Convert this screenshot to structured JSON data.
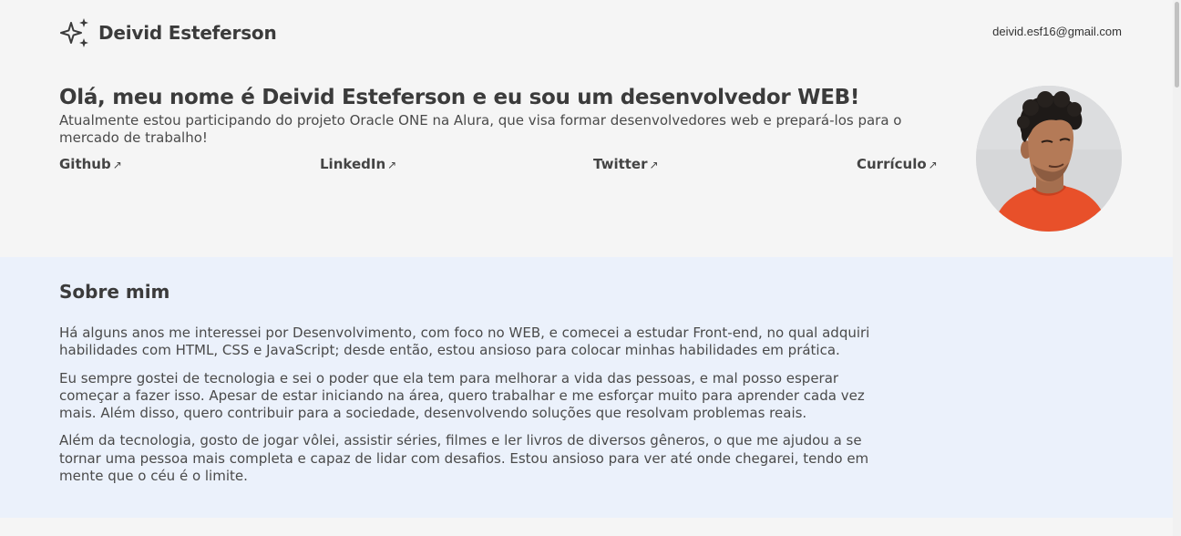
{
  "header": {
    "name": "Deivid Esteferson",
    "logo_icon": "sparkles-icon",
    "email": "deivid.esf16@gmail.com"
  },
  "hero": {
    "title": "Olá, meu nome é Deivid Esteferson e eu sou um desenvolvedor WEB!",
    "intro": "Atualmente estou participando do projeto Oracle ONE na Alura, que visa formar desenvolvedores web e prepará-los para o mercado de trabalho!",
    "links": [
      {
        "label": "Github",
        "icon": "arrow-up-right-icon"
      },
      {
        "label": "LinkedIn",
        "icon": "arrow-up-right-icon"
      },
      {
        "label": "Twitter",
        "icon": "arrow-up-right-icon"
      },
      {
        "label": "Currículo",
        "icon": "arrow-up-right-icon"
      }
    ]
  },
  "about": {
    "title": "Sobre mim",
    "paragraphs": [
      "Há alguns anos me interessei por Desenvolvimento, com foco no WEB, e comecei a estudar Front-end, no qual adquiri habilidades com HTML, CSS e JavaScript; desde então, estou ansioso para colocar minhas habilidades em prática.",
      "Eu sempre gostei de tecnologia e sei o poder que ela tem para melhorar a vida das pessoas, e mal posso esperar começar a fazer isso. Apesar de estar iniciando na área, quero trabalhar e me esforçar muito para aprender cada vez mais. Além disso, quero contribuir para a sociedade, desenvolvendo soluções que resolvam problemas reais.",
      "Além da tecnologia, gosto de jogar vôlei, assistir séries, filmes e ler livros de diversos gêneros, o que me ajudou a se tornar uma pessoa mais completa e capaz de lidar com desafios. Estou ansioso para ver até onde chegarei, tendo em mente que o céu é o limite."
    ]
  },
  "colors": {
    "text": "#444444",
    "page_background": "#f5f5f5",
    "about_background": "#ebf1fb",
    "shirt": "#e8502a"
  }
}
